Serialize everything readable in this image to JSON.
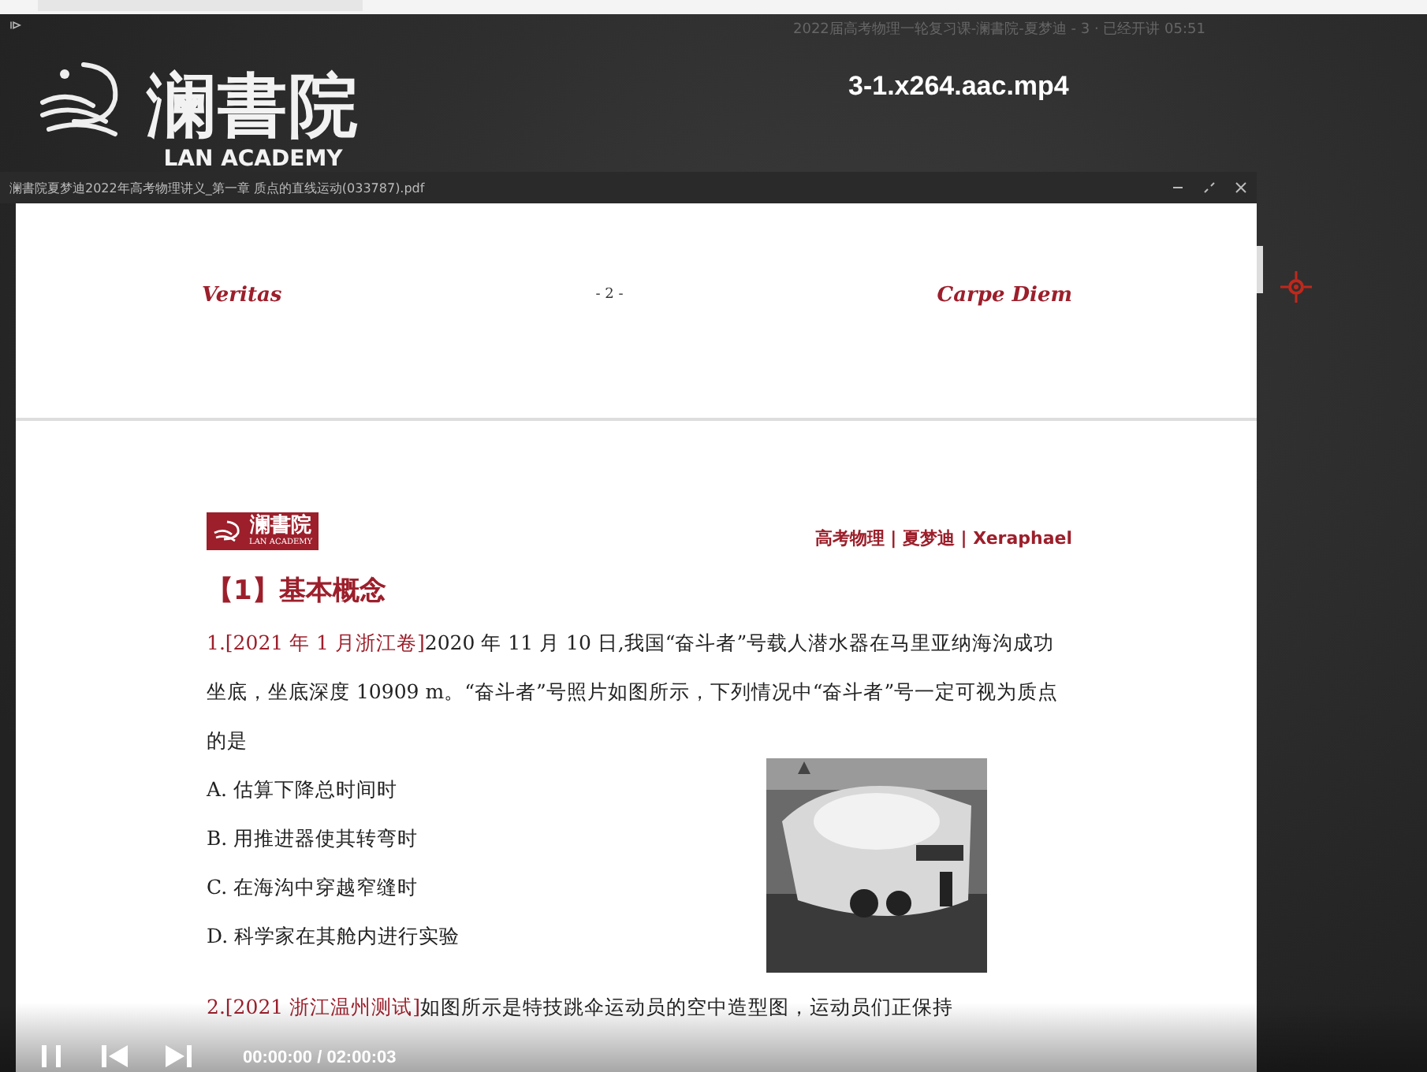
{
  "player": {
    "top_title": "2022届高考物理一轮复习课-澜書院-夏梦迪 - 3 · 已经开讲 05:51",
    "video_title": "3-1.x264.aac.mp4",
    "logo": {
      "name": "澜書院",
      "subtitle": "LAN ACADEMY"
    }
  },
  "pdf_window": {
    "title": "澜書院夏梦迪2022年高考物理讲义_第一章 质点的直线运动(033787).pdf"
  },
  "page": {
    "header_left": "Veritas",
    "page_number": "- 2 -",
    "header_right": "Carpe Diem",
    "brand_logo": {
      "name": "澜書院",
      "subtitle": "LAN ACADEMY"
    },
    "byline": "高考物理 | 夏梦迪 | Xeraphael",
    "section_title": "【1】基本概念",
    "questions": [
      {
        "number": "1.",
        "source": "[2021 年 1 月浙江卷]",
        "text": "2020 年 11 月 10 日,我国“奋斗者”号载人潜水器在马里亚纳海沟成功坐底，坐底深度 10909 m。“奋斗者”号照片如图所示，下列情况中“奋斗者”号一定可视为质点的是",
        "options": [
          "A. 估算下降总时间时",
          "B. 用推进器使其转弯时",
          "C. 在海沟中穿越窄缝时",
          "D. 科学家在其舱内进行实验"
        ]
      },
      {
        "number": "2.",
        "source": "[2021 浙江温州测试]",
        "text": "如图所示是特技跳伞运动员的空中造型图，运动员们正保持"
      }
    ]
  },
  "controls": {
    "time": "00:00:00 / 02:00:03"
  }
}
